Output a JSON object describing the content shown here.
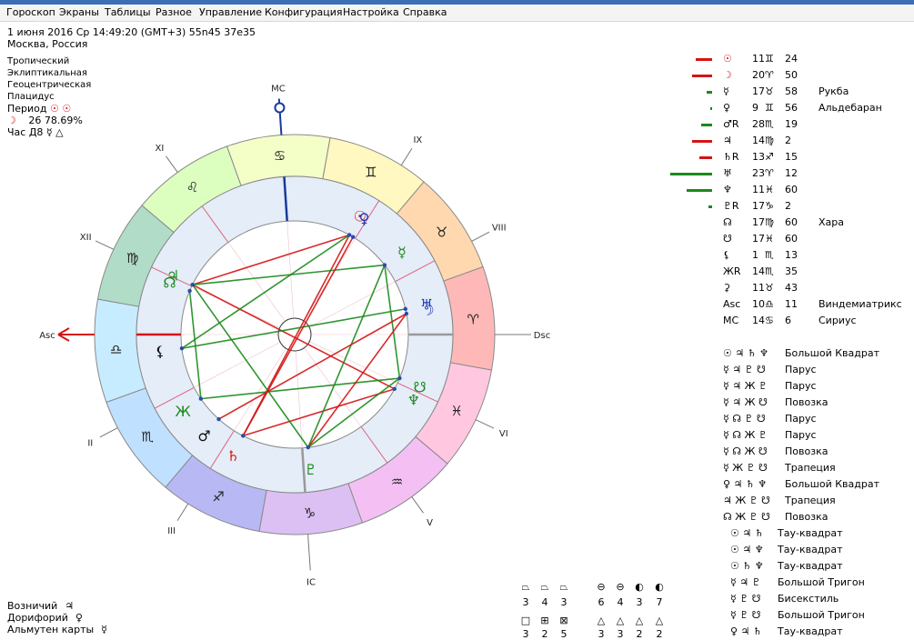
{
  "menu": [
    "Гороскоп",
    "Экраны",
    "Таблицы",
    "Разное",
    "Управление",
    "Конфигурация",
    "Настройка",
    "Справка"
  ],
  "header": {
    "date_line": "1 июня 2016  Ср  14:49:20 (GMT+3) 55n45  37e35",
    "location": "Москва, Россия"
  },
  "settings": {
    "zodiac": "Тропический",
    "coords": "Эклиптикальная",
    "center": "Геоцентрическая",
    "houses": "Плацидус",
    "period_label": "Период",
    "period_glyphs": "☉ ☉",
    "moon_glyph": "☽",
    "moon_info": "26 78.69%",
    "hour_label": "Час Д8",
    "hour_glyphs": "☿ △"
  },
  "wheel": {
    "house_labels": [
      "Asc",
      "II",
      "III",
      "IC",
      "V",
      "VI",
      "Dsc",
      "VIII",
      "IX",
      "MC",
      "XI",
      "XII"
    ],
    "sign_glyphs": [
      "♎",
      "♏",
      "♐",
      "♑",
      "♒",
      "♓",
      "♈",
      "♉",
      "♊",
      "♋",
      "♌",
      "♍"
    ],
    "sign_colors": [
      "#c8ecff",
      "#c0e0ff",
      "#b8b8f4",
      "#dcc0f4",
      "#f4c0f4",
      "#ffc8e0",
      "#ffb8b8",
      "#ffd8b0",
      "#fff8c0",
      "#f4ffc8",
      "#dcffc0",
      "#b0dcc8"
    ],
    "planets": [
      {
        "glyph": "☉",
        "color": "red",
        "lon": 71.4
      },
      {
        "glyph": "♀",
        "color": "blue",
        "lon": 69.3
      },
      {
        "glyph": "☿",
        "color": "green",
        "lon": 47.9
      },
      {
        "glyph": "♃",
        "color": "green",
        "lon": 164.2
      },
      {
        "glyph": "♂",
        "color": "black",
        "lon": 238.3
      },
      {
        "glyph": "♄",
        "color": "red",
        "lon": 253.2
      },
      {
        "glyph": "♅",
        "color": "blue",
        "lon": 23.2
      },
      {
        "glyph": "♆",
        "color": "green",
        "lon": 341.6
      },
      {
        "glyph": "♇",
        "color": "green",
        "lon": 287.0
      },
      {
        "glyph": "☽",
        "color": "blue",
        "lon": 20.8
      },
      {
        "glyph": "☊",
        "color": "green",
        "lon": 167.6
      },
      {
        "glyph": "☋",
        "color": "green",
        "lon": 347.6
      },
      {
        "glyph": "⚸",
        "color": "black",
        "lon": 197.2
      },
      {
        "glyph": "Ж",
        "color": "green",
        "lon": 224.6
      }
    ]
  },
  "planet_table": [
    {
      "glyph": "☉",
      "deg": "11",
      "sign": "♊",
      "min": "24",
      "star": ""
    },
    {
      "glyph": "☽",
      "deg": "20",
      "sign": "♈",
      "min": "50",
      "star": ""
    },
    {
      "glyph": "☿",
      "deg": "17",
      "sign": "♉",
      "min": "58",
      "star": "Рукба"
    },
    {
      "glyph": "♀",
      "deg": "9",
      "sign": "♊",
      "min": "56",
      "star": "Альдебаран"
    },
    {
      "glyph": "♂R",
      "deg": "28",
      "sign": "♏",
      "min": "19",
      "star": ""
    },
    {
      "glyph": "♃",
      "deg": "14",
      "sign": "♍",
      "min": "2",
      "star": ""
    },
    {
      "glyph": "♄R",
      "deg": "13",
      "sign": "♐",
      "min": "15",
      "star": ""
    },
    {
      "glyph": "♅",
      "deg": "23",
      "sign": "♈",
      "min": "12",
      "star": ""
    },
    {
      "glyph": "♆",
      "deg": "11",
      "sign": "♓",
      "min": "60",
      "star": ""
    },
    {
      "glyph": "♇R",
      "deg": "17",
      "sign": "♑",
      "min": "2",
      "star": ""
    },
    {
      "glyph": "☊",
      "deg": "17",
      "sign": "♍",
      "min": "60",
      "star": "Хара"
    },
    {
      "glyph": "☋",
      "deg": "17",
      "sign": "♓",
      "min": "60",
      "star": ""
    },
    {
      "glyph": "⚸",
      "deg": "1",
      "sign": "♏",
      "min": "13",
      "star": ""
    },
    {
      "glyph": "ЖR",
      "deg": "14",
      "sign": "♏",
      "min": "35",
      "star": ""
    },
    {
      "glyph": "⚳",
      "deg": "11",
      "sign": "♉",
      "min": "43",
      "star": ""
    },
    {
      "glyph": "Asc",
      "deg": "10",
      "sign": "♎",
      "min": "11",
      "star": "Виндемиатрикс"
    },
    {
      "glyph": "MC",
      "deg": "14",
      "sign": "♋",
      "min": "6",
      "star": "Сириус"
    }
  ],
  "configurations": [
    {
      "glyphs": "☉ ♃ ♄ ♆",
      "name": "Большой Квадрат"
    },
    {
      "glyphs": "☿ ♃ ♇ ☋",
      "name": "Парус"
    },
    {
      "glyphs": "☿ ♃ Ж ♇",
      "name": "Парус"
    },
    {
      "glyphs": "☿ ♃ Ж ☋",
      "name": "Повозка"
    },
    {
      "glyphs": "☿ ☊ ♇ ☋",
      "name": "Парус"
    },
    {
      "glyphs": "☿ ☊ Ж ♇",
      "name": "Парус"
    },
    {
      "glyphs": "☿ ☊ Ж ☋",
      "name": "Повозка"
    },
    {
      "glyphs": "☿ Ж ♇ ☋",
      "name": "Трапеция"
    },
    {
      "glyphs": "♀ ♃ ♄ ♆",
      "name": "Большой Квадрат"
    },
    {
      "glyphs": "♃ Ж ♇ ☋",
      "name": "Трапеция"
    },
    {
      "glyphs": "☊ Ж ♇ ☋",
      "name": "Повозка"
    },
    {
      "glyphs": "☉ ♃ ♄",
      "name": "Тау-квадрат"
    },
    {
      "glyphs": "☉ ♃ ♆",
      "name": "Тау-квадрат"
    },
    {
      "glyphs": "☉ ♄ ♆",
      "name": "Тау-квадрат"
    },
    {
      "glyphs": "☿ ♃ ♇",
      "name": "Большой Тригон"
    },
    {
      "glyphs": "☿ ♇ ☋",
      "name": "Бисекстиль"
    },
    {
      "glyphs": "☿ ♇ ☋",
      "name": "Большой Тригон"
    },
    {
      "glyphs": "♀ ♃ ♄",
      "name": "Тау-квадрат"
    }
  ],
  "rulers": [
    {
      "label": "Возничий",
      "glyph": "♃"
    },
    {
      "label": "Дорифорий",
      "glyph": "♀"
    },
    {
      "label": "Альмутен карты",
      "glyph": "☿"
    }
  ],
  "quality_counts": {
    "top_glyphs": [
      "⏢",
      "⏢",
      "⏢",
      "⊖",
      "⊖",
      "◐",
      "◐"
    ],
    "top_values": [
      "3",
      "4",
      "3",
      "6",
      "4",
      "3",
      "7"
    ],
    "bottom_glyphs": [
      "□",
      "⊞",
      "⊠",
      "△",
      "△",
      "△",
      "△"
    ],
    "bottom_values": [
      "3",
      "2",
      "5",
      "3",
      "3",
      "2",
      "2"
    ]
  }
}
